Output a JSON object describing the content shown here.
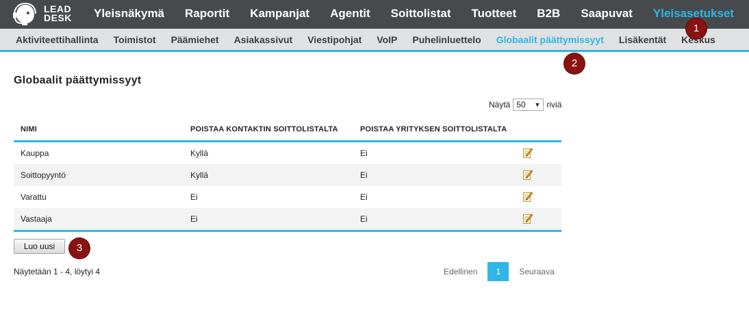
{
  "brand": {
    "line1": "LEAD",
    "line2": "DESK"
  },
  "topnav": [
    {
      "label": "Yleisnäkymä",
      "active": false
    },
    {
      "label": "Raportit",
      "active": false
    },
    {
      "label": "Kampanjat",
      "active": false
    },
    {
      "label": "Agentit",
      "active": false
    },
    {
      "label": "Soittolistat",
      "active": false
    },
    {
      "label": "Tuotteet",
      "active": false
    },
    {
      "label": "B2B",
      "active": false
    },
    {
      "label": "Saapuvat",
      "active": false
    },
    {
      "label": "Yleisasetukset",
      "active": true
    }
  ],
  "subnav": [
    {
      "label": "Aktiviteettihallinta",
      "active": false
    },
    {
      "label": "Toimistot",
      "active": false
    },
    {
      "label": "Päämiehet",
      "active": false
    },
    {
      "label": "Asiakassivut",
      "active": false
    },
    {
      "label": "Viestipohjat",
      "active": false
    },
    {
      "label": "VoIP",
      "active": false
    },
    {
      "label": "Puhelinluettelo",
      "active": false
    },
    {
      "label": "Globaalit päättymissyyt",
      "active": true
    },
    {
      "label": "Lisäkentät",
      "active": false
    },
    {
      "label": "Keskus",
      "active": false
    }
  ],
  "markers": [
    "1",
    "2",
    "3"
  ],
  "page": {
    "title": "Globaalit päättymissyyt",
    "rows_prefix": "Näytä",
    "rows_value": "50",
    "rows_suffix": "riviä",
    "create_label": "Luo uusi",
    "result_count": "Näytetään 1 - 4, löytyi 4"
  },
  "table": {
    "headers": [
      "NIMI",
      "POISTAA KONTAKTIN SOITTOLISTALTA",
      "POISTAA YRITYKSEN SOITTOLISTALTA"
    ],
    "rows": [
      {
        "name": "Kauppa",
        "contact": "Kyllä",
        "company": "Ei"
      },
      {
        "name": "Soittopyyntö",
        "contact": "Kyllä",
        "company": "Ei"
      },
      {
        "name": "Varattu",
        "contact": "Ei",
        "company": "Ei"
      },
      {
        "name": "Vastaaja",
        "contact": "Ei",
        "company": "Ei"
      }
    ]
  },
  "pager": {
    "prev": "Edellinen",
    "current": "1",
    "next": "Seuraava"
  },
  "colors": {
    "accent": "#2fb6e6",
    "topbar": "#474a4d",
    "subnav": "#dfe1e3",
    "marker": "#8b1212"
  },
  "icons": {
    "edit": "pencil-edit-icon",
    "logo": "headset-logo-icon"
  }
}
